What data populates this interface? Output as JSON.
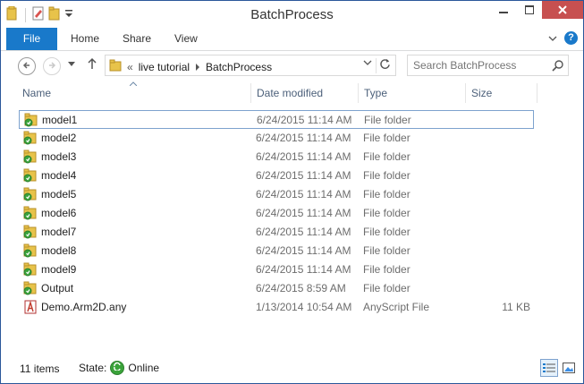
{
  "window": {
    "title": "BatchProcess"
  },
  "ribbon": {
    "tabs": [
      {
        "label": "File"
      },
      {
        "label": "Home"
      },
      {
        "label": "Share"
      },
      {
        "label": "View"
      }
    ],
    "help_label": "?"
  },
  "navigation": {
    "breadcrumb": [
      "live tutorial",
      "BatchProcess"
    ],
    "overflow_label": "«"
  },
  "search": {
    "placeholder": "Search BatchProcess"
  },
  "columns": {
    "name": "Name",
    "date": "Date modified",
    "type": "Type",
    "size": "Size"
  },
  "files": [
    {
      "name": "model1",
      "date": "6/24/2015 11:14 AM",
      "type": "File folder",
      "size": "",
      "icon": "synced-folder-icon"
    },
    {
      "name": "model2",
      "date": "6/24/2015 11:14 AM",
      "type": "File folder",
      "size": "",
      "icon": "synced-folder-icon"
    },
    {
      "name": "model3",
      "date": "6/24/2015 11:14 AM",
      "type": "File folder",
      "size": "",
      "icon": "synced-folder-icon"
    },
    {
      "name": "model4",
      "date": "6/24/2015 11:14 AM",
      "type": "File folder",
      "size": "",
      "icon": "synced-folder-icon"
    },
    {
      "name": "model5",
      "date": "6/24/2015 11:14 AM",
      "type": "File folder",
      "size": "",
      "icon": "synced-folder-icon"
    },
    {
      "name": "model6",
      "date": "6/24/2015 11:14 AM",
      "type": "File folder",
      "size": "",
      "icon": "synced-folder-icon"
    },
    {
      "name": "model7",
      "date": "6/24/2015 11:14 AM",
      "type": "File folder",
      "size": "",
      "icon": "synced-folder-icon"
    },
    {
      "name": "model8",
      "date": "6/24/2015 11:14 AM",
      "type": "File folder",
      "size": "",
      "icon": "synced-folder-icon"
    },
    {
      "name": "model9",
      "date": "6/24/2015 11:14 AM",
      "type": "File folder",
      "size": "",
      "icon": "synced-folder-icon"
    },
    {
      "name": "Output",
      "date": "6/24/2015 8:59 AM",
      "type": "File folder",
      "size": "",
      "icon": "synced-folder-icon"
    },
    {
      "name": "Demo.Arm2D.any",
      "date": "1/13/2014 10:54 AM",
      "type": "AnyScript File",
      "size": "11 KB",
      "icon": "anyscript-file-icon"
    }
  ],
  "status": {
    "item_count": "11 items",
    "state_label": "State:",
    "state_value": "Online"
  },
  "colors": {
    "accent": "#1979ca",
    "folder": "#e8c34a",
    "sync_green": "#3aa33a",
    "focus_border": "#7da2ce"
  }
}
